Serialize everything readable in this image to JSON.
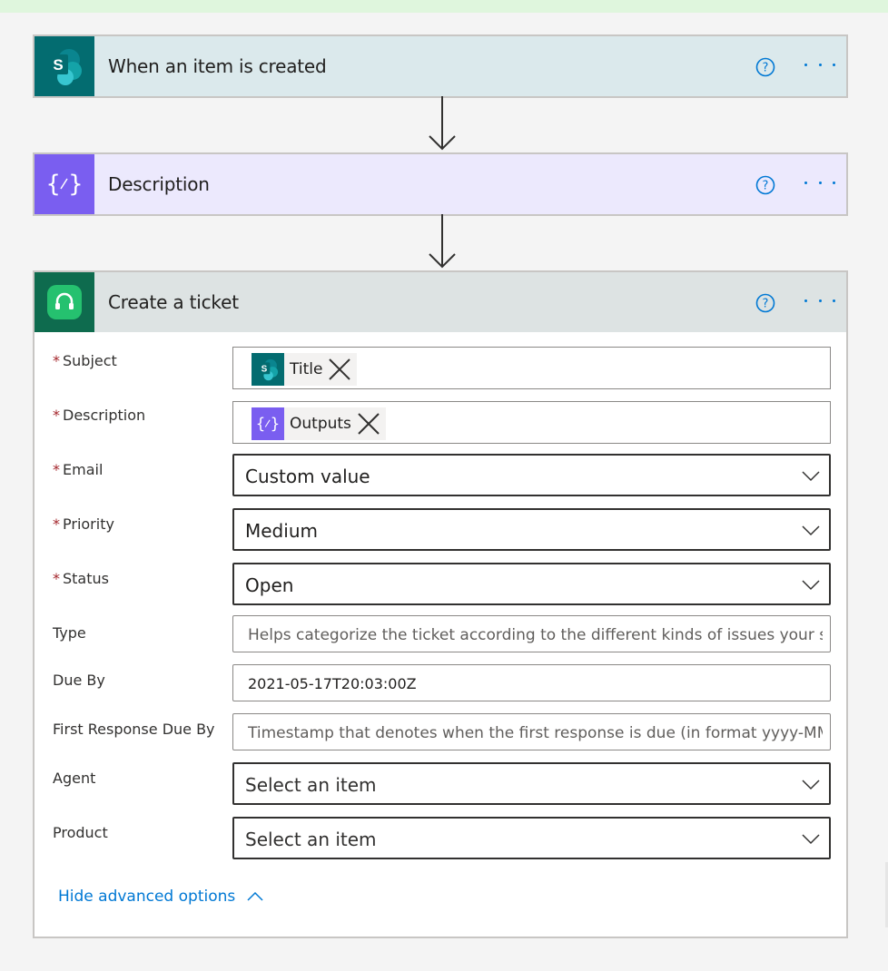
{
  "flow": {
    "steps": [
      {
        "title": "When an item is created",
        "icon": "sharepoint-icon",
        "color": "#036c70"
      },
      {
        "title": "Description",
        "icon": "variable-braces-icon",
        "color": "#7a5ef0"
      },
      {
        "title": "Create a ticket",
        "icon": "headset-icon",
        "color": "#0e6b4e"
      }
    ]
  },
  "form": {
    "subject": {
      "label": "Subject",
      "required": "*",
      "token": "Title",
      "token_icon": "sharepoint-icon"
    },
    "description": {
      "label": "Description",
      "required": "*",
      "token": "Outputs",
      "token_icon": "variable-braces-icon"
    },
    "email": {
      "label": "Email",
      "required": "*",
      "value": "Custom value"
    },
    "priority": {
      "label": "Priority",
      "required": "*",
      "value": "Medium"
    },
    "status": {
      "label": "Status",
      "required": "*",
      "value": "Open"
    },
    "type": {
      "label": "Type",
      "placeholder": "Helps categorize the ticket according to the different kinds of issues your suppo"
    },
    "due_by": {
      "label": "Due By",
      "value": "2021-05-17T20:03:00Z"
    },
    "first_response": {
      "label": "First Response Due By",
      "placeholder": "Timestamp that denotes when the first response is due (in format yyyy-MM-dd"
    },
    "agent": {
      "label": "Agent",
      "value": "Select an item"
    },
    "product": {
      "label": "Product",
      "value": "Select an item"
    }
  },
  "advanced_link": "Hide advanced options",
  "colors": {
    "accent": "#0078d4",
    "required": "#a4262c"
  }
}
